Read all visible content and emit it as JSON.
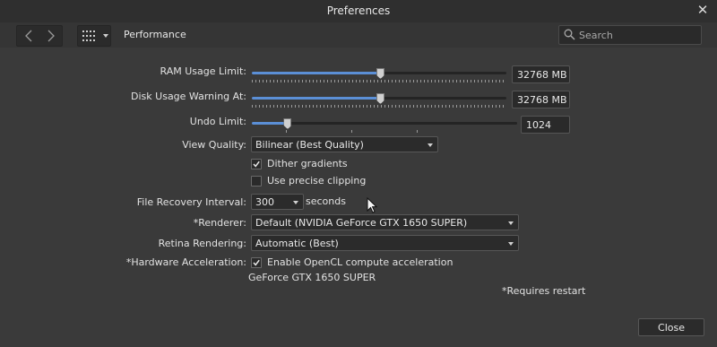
{
  "window": {
    "title": "Preferences"
  },
  "toolbar": {
    "section": "Performance"
  },
  "search": {
    "placeholder": "Search"
  },
  "ram": {
    "label": "RAM Usage Limit:",
    "value": "32768 MB",
    "fraction": 0.5
  },
  "disk": {
    "label": "Disk Usage Warning At:",
    "value": "32768 MB",
    "fraction": 0.5
  },
  "undo": {
    "label": "Undo Limit:",
    "value": "1024",
    "fraction": 0.13
  },
  "view_quality": {
    "label": "View Quality:",
    "value": "Bilinear (Best Quality)"
  },
  "dither": {
    "label": "Dither gradients",
    "checked": true
  },
  "precise_clipping": {
    "label": "Use precise clipping",
    "checked": false
  },
  "file_recovery": {
    "label": "File Recovery Interval:",
    "value": "300",
    "unit": "seconds"
  },
  "renderer": {
    "label": "*Renderer:",
    "value": "Default (NVIDIA GeForce GTX 1650 SUPER)"
  },
  "retina": {
    "label": "Retina Rendering:",
    "value": "Automatic (Best)"
  },
  "hardware_accel": {
    "label": "*Hardware Acceleration:",
    "option": "Enable OpenCL compute acceleration",
    "checked": true,
    "gpu": "GeForce GTX 1650 SUPER"
  },
  "footer": {
    "restart_note": "*Requires restart",
    "close_label": "Close"
  },
  "colors": {
    "accent": "#5b8fd6",
    "background": "#3a3a3a"
  }
}
